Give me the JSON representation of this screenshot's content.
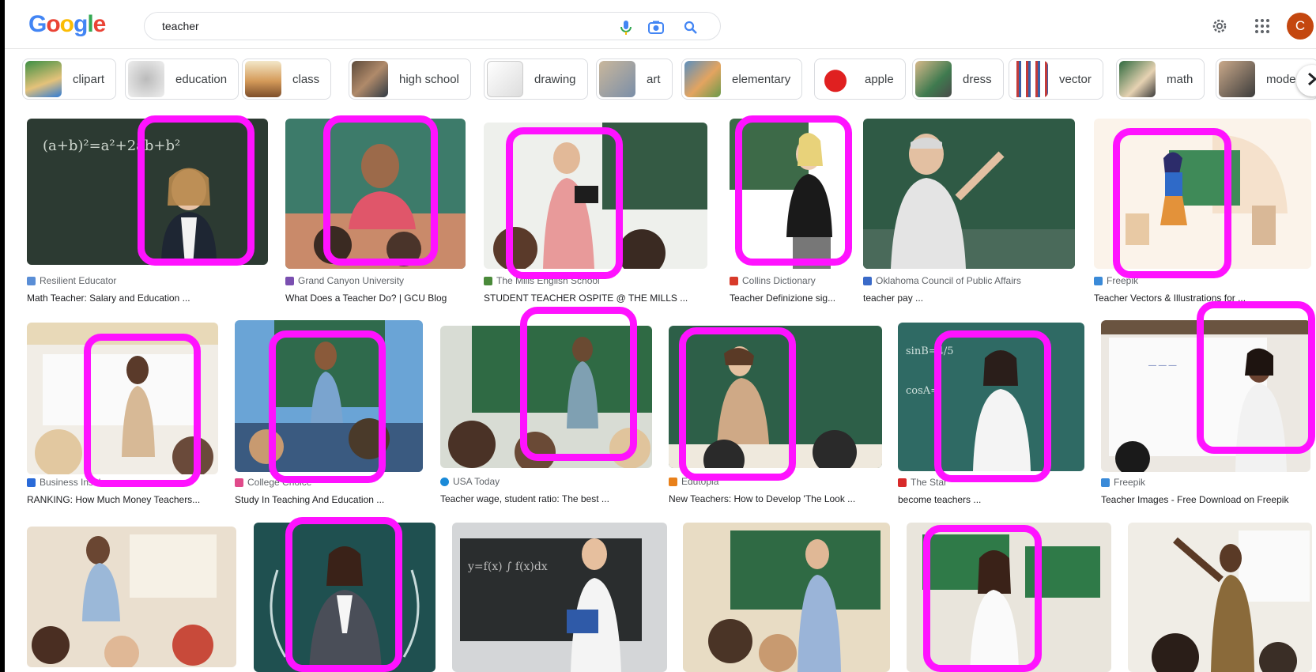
{
  "logo": {
    "letters": [
      "G",
      "o",
      "o",
      "g",
      "l",
      "e"
    ],
    "colors": [
      "#4285f4",
      "#ea4335",
      "#fbbc05",
      "#4285f4",
      "#34a853",
      "#ea4335"
    ]
  },
  "search": {
    "value": "teacher"
  },
  "header": {
    "icons": [
      "mic-icon",
      "camera-icon",
      "search-icon",
      "gear-icon",
      "apps-grid-icon"
    ],
    "avatar_letter": "C",
    "avatar_color": "#c4470f"
  },
  "chips": [
    {
      "label": "clipart"
    },
    {
      "label": "education"
    },
    {
      "label": "class"
    },
    {
      "label": "high school"
    },
    {
      "label": "drawing"
    },
    {
      "label": "art"
    },
    {
      "label": "elementary"
    },
    {
      "label": "apple"
    },
    {
      "label": "dress"
    },
    {
      "label": "vector"
    },
    {
      "label": "math"
    },
    {
      "label": "mode"
    }
  ],
  "results": [
    {
      "source": "Resilient Educator",
      "caption": "Math Teacher: Salary and Education ..."
    },
    {
      "source": "Grand Canyon University",
      "caption": "What Does a Teacher Do? | GCU Blog"
    },
    {
      "source": "The Mills English School",
      "caption": "STUDENT TEACHER OSPITE @ THE MILLS ..."
    },
    {
      "source": "Collins Dictionary",
      "caption": "Teacher Definizione sig..."
    },
    {
      "source": "Oklahoma Council of Public Affairs",
      "caption": "teacher pay ..."
    },
    {
      "source": "Freepik",
      "caption": "Teacher Vectors & Illustrations for ..."
    },
    {
      "source": "Business Insider",
      "caption": "RANKING: How Much Money Teachers..."
    },
    {
      "source": "College Choice",
      "caption": "Study In Teaching And Education ..."
    },
    {
      "source": "USA Today",
      "caption": "Teacher wage, student ratio: The best ..."
    },
    {
      "source": "Edutopia",
      "caption": "New Teachers: How to Develop 'The Look ..."
    },
    {
      "source": "The Star",
      "caption": "become teachers ..."
    },
    {
      "source": "Freepik",
      "caption": "Teacher Images - Free Download on Freepik"
    },
    {
      "source": "",
      "caption": ""
    },
    {
      "source": "",
      "caption": ""
    },
    {
      "source": "",
      "caption": ""
    },
    {
      "source": "",
      "caption": ""
    },
    {
      "source": "",
      "caption": ""
    },
    {
      "source": "",
      "caption": ""
    }
  ],
  "highlight_color": "#ff12ff",
  "chip_next_icon": "chevron-right-icon"
}
